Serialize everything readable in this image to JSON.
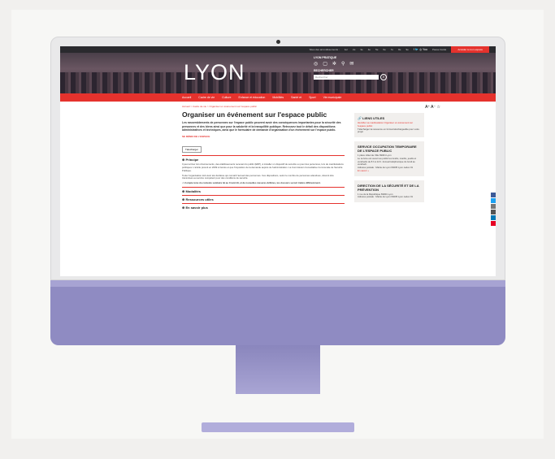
{
  "topbar": {
    "links": [
      "Sites des arrondissements :",
      "1er",
      "2e",
      "3e",
      "4e",
      "5e",
      "6e",
      "7e",
      "8e",
      "9e"
    ],
    "social": "f  🐦  ◎  You",
    "access": "Pause Guide",
    "button": "Accéder à mon espace"
  },
  "hero": {
    "logo": "LYON",
    "quick_title": "LYON PRATIQUE",
    "quick_items": [
      "Proxi",
      "Démarches",
      "Horaires",
      "Marchés",
      "Infos"
    ],
    "search_title": "RECHERCHER",
    "search_placeholder": "Rechercher"
  },
  "nav": [
    "Accueil",
    "Cadre de vie",
    "Culture",
    "Enfance et éducation",
    "Mobilités",
    "Santé et",
    "Sport",
    "Vie municipale"
  ],
  "breadcrumb": "Accueil > Cadre de vie > Organiser un événement sur l'espace public",
  "title": "Organiser un événement sur l'espace public",
  "intro": "Les rassemblements de personnes sur l'espace public peuvent avoir des conséquences importantes pour la sécurité des personnes et des biens ainsi que pour la salubrité et la tranquillité publique. Retrouvez tout le détail des dispositions administratives et techniques, ainsi que le formulaire de demande d'organisation d'un événement sur l'espace public.",
  "subtitle": "SE DÉMO DE L'ESPACE",
  "chip": "Télécharger",
  "sections": [
    {
      "label": "Principe"
    },
    {
      "label": "Modalités"
    },
    {
      "label": "Ressources utiles"
    },
    {
      "label": "En savoir plus"
    }
  ],
  "principe_text": "Il peut arriver lors d'événements, des établissements recevant du public (ERP), à installer un dispositif de sécurité ou pour des personnes, lors de manifestations publiques. L'article prévoit en 2009 à l'accès et que l'imposition de la demande auprès de l'administration. La Commission Consultative Communale de Sécurité Publique.",
  "principe_text2": "Toute l'organisation doit avoir été déclarée qui connaît l'accueil des personnes. Ces dispositions, selon le nombre de personnes attendues, doivent être transmises au service compétent pour des conditions de sécurité.",
  "notice": "Compte tenu du contexte sanitaire lié au Covid-19, et de nouvelles mesures définies, les dossiers seront traités différemment.",
  "toolbar": "A⁺ A⁻ ☆",
  "side": {
    "links_title": "LIENS UTILES",
    "links_text": "Identifier sa manifestation Organiser un événement sur l'espace public",
    "links_text2": "Télécharger la ressource en format téléchargeable pour votre projet",
    "service_title": "SERVICE OCCUPATION TEMPORAIRE DE L'ESPACE PUBLIC",
    "service_addr": "1 place Hôtel de Ville 69001 Lyon",
    "service_hours": "Le service est ouvert au public les lundis, mardis, jeudis et vendredis de 8 h à 12 h. Accueil téléphonique du lundi au vendredi.",
    "service_tel": "Adresse postale : Mairie de Lyon 69205 Lyon cedex 01",
    "service_more": "En savoir +",
    "prev_title": "DIRECTION DE LA SÉCURITÉ ET DE LA PRÉVENTION",
    "prev_addr": "1 rue de la République 69001 Lyon",
    "prev_tel": "Adresse postale : Mairie de Lyon 69205 Lyon cedex 01"
  },
  "colors": {
    "brand_red": "#e5322d",
    "chin": "#8f8bc2"
  }
}
